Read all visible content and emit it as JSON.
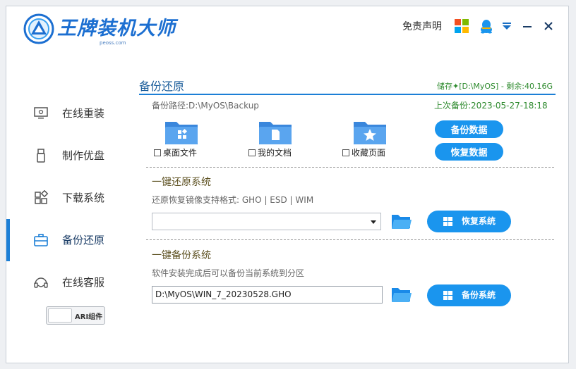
{
  "header": {
    "brand": "王牌装机大师",
    "brand_sub": "peoss.com",
    "disclaimer": "免责声明"
  },
  "sidebar": {
    "items": [
      {
        "label": "在线重装",
        "icon": "monitor-icon"
      },
      {
        "label": "制作优盘",
        "icon": "usb-drive-icon"
      },
      {
        "label": "下载系统",
        "icon": "grid-apps-icon"
      },
      {
        "label": "备份还原",
        "icon": "briefcase-icon",
        "active": true
      },
      {
        "label": "在线客服",
        "icon": "headset-icon"
      }
    ],
    "toggle_label": "ARI组件"
  },
  "backup": {
    "title": "备份还原",
    "storage": "储存✦[D:\\MyOS] - 剩余:40.16G",
    "path": "备份路径:D:\\MyOS\\Backup",
    "last_backup": "上次备份:2023-05-27-18:18",
    "items": [
      {
        "label": "桌面文件",
        "icon": "desktop-folder-icon"
      },
      {
        "label": "我的文档",
        "icon": "document-folder-icon"
      },
      {
        "label": "收藏页面",
        "icon": "favorites-folder-icon"
      }
    ],
    "backup_data_button": "备份数据",
    "restore_data_button": "恢复数据"
  },
  "restore_system": {
    "title": "一键还原系统",
    "desc": "还原恢复镜像支持格式: GHO | ESD | WIM",
    "select_value": "",
    "button": "恢复系统"
  },
  "backup_system": {
    "title": "一键备份系统",
    "desc": "软件安装完成后可以备份当前系统到分区",
    "path_value": "D:\\MyOS\\WIN_7_20230528.GHO",
    "button": "备份系统"
  },
  "colors": {
    "accent": "#1a95ee",
    "brand": "#1c6fd1",
    "green_text": "#2d8a2d",
    "folder": "#4f9bea"
  }
}
